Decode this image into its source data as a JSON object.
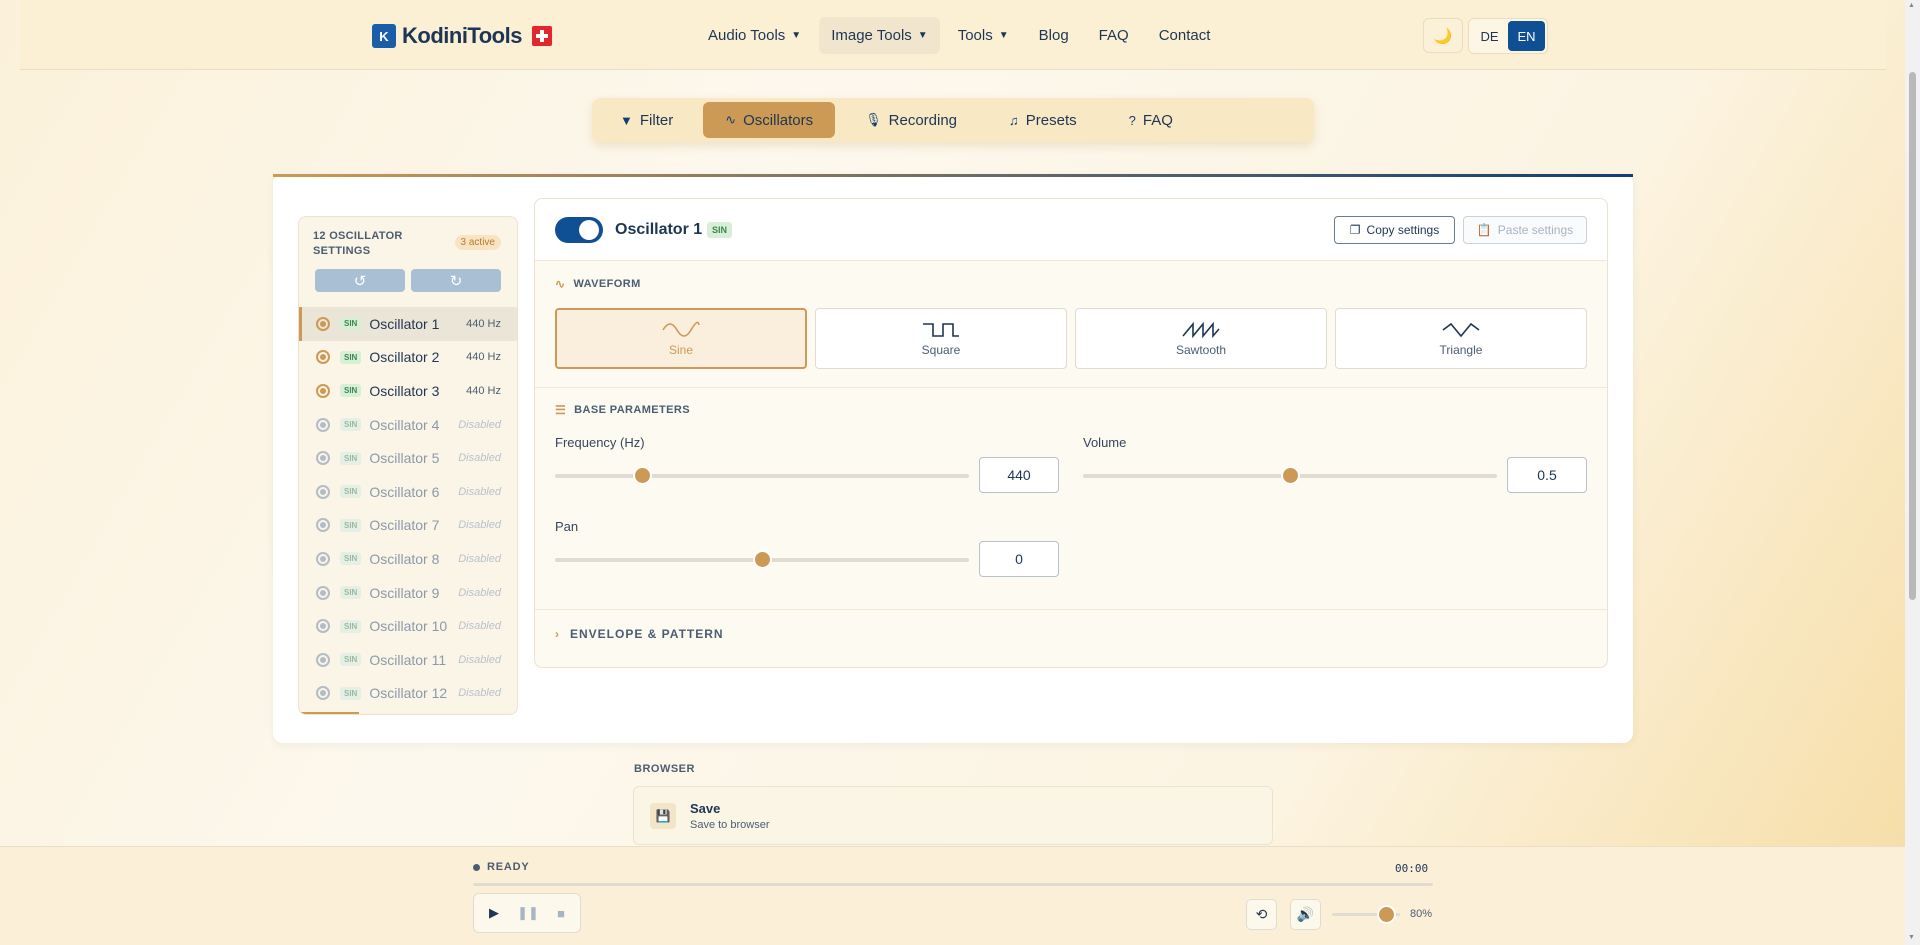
{
  "header": {
    "logo_mark": "K",
    "brand": "KodiniTools",
    "nav": [
      {
        "label": "Audio Tools",
        "dropdown": true
      },
      {
        "label": "Image Tools",
        "dropdown": true
      },
      {
        "label": "Tools",
        "dropdown": true
      },
      {
        "label": "Blog",
        "dropdown": false
      },
      {
        "label": "FAQ",
        "dropdown": false
      },
      {
        "label": "Contact",
        "dropdown": false
      }
    ],
    "theme_icon": "moon-icon",
    "theme_glyph": "🌙",
    "languages": [
      "DE",
      "EN"
    ],
    "active_language": "EN"
  },
  "tabs": [
    {
      "label": "Filter",
      "icon": "filter-icon",
      "glyph": "▼"
    },
    {
      "label": "Oscillators",
      "icon": "wave-icon",
      "glyph": "∿"
    },
    {
      "label": "Recording",
      "icon": "microphone-icon",
      "glyph": "🎙"
    },
    {
      "label": "Presets",
      "icon": "music-note-icon",
      "glyph": "♫"
    },
    {
      "label": "FAQ",
      "icon": "question-icon",
      "glyph": "?"
    }
  ],
  "active_tab": "Oscillators",
  "sidebar": {
    "title": "12 OSCILLATOR SETTINGS",
    "active_badge": "3 active",
    "undo_glyph": "↺",
    "redo_glyph": "↻",
    "oscillators": [
      {
        "name": "Oscillator 1",
        "wave": "SIN",
        "status": "440 Hz",
        "enabled": true
      },
      {
        "name": "Oscillator 2",
        "wave": "SIN",
        "status": "440 Hz",
        "enabled": true
      },
      {
        "name": "Oscillator 3",
        "wave": "SIN",
        "status": "440 Hz",
        "enabled": true
      },
      {
        "name": "Oscillator 4",
        "wave": "SIN",
        "status": "Disabled",
        "enabled": false
      },
      {
        "name": "Oscillator 5",
        "wave": "SIN",
        "status": "Disabled",
        "enabled": false
      },
      {
        "name": "Oscillator 6",
        "wave": "SIN",
        "status": "Disabled",
        "enabled": false
      },
      {
        "name": "Oscillator 7",
        "wave": "SIN",
        "status": "Disabled",
        "enabled": false
      },
      {
        "name": "Oscillator 8",
        "wave": "SIN",
        "status": "Disabled",
        "enabled": false
      },
      {
        "name": "Oscillator 9",
        "wave": "SIN",
        "status": "Disabled",
        "enabled": false
      },
      {
        "name": "Oscillator 10",
        "wave": "SIN",
        "status": "Disabled",
        "enabled": false
      },
      {
        "name": "Oscillator 11",
        "wave": "SIN",
        "status": "Disabled",
        "enabled": false
      },
      {
        "name": "Oscillator 12",
        "wave": "SIN",
        "status": "Disabled",
        "enabled": false
      }
    ]
  },
  "panel": {
    "title": "Oscillator 1",
    "wave_tag": "SIN",
    "enabled": true,
    "copy_label": "Copy settings",
    "paste_label": "Paste settings",
    "waveform_label": "WAVEFORM",
    "waveforms": [
      "Sine",
      "Square",
      "Sawtooth",
      "Triangle"
    ],
    "selected_waveform": "Sine",
    "base_label": "BASE PARAMETERS",
    "frequency": {
      "label": "Frequency (Hz)",
      "value": "440",
      "fraction": 0.21
    },
    "volume": {
      "label": "Volume",
      "value": "0.5",
      "fraction": 0.5
    },
    "pan": {
      "label": "Pan",
      "value": "0",
      "fraction": 0.5
    },
    "envelope_label": "ENVELOPE & PATTERN"
  },
  "browser": {
    "label": "BROWSER",
    "save_title": "Save",
    "save_subtitle": "Save to browser"
  },
  "player": {
    "status": "READY",
    "time": "00:00",
    "progress": 0,
    "volume_percent": "80%",
    "volume_fraction": 0.8
  },
  "colors": {
    "accent": "#cc9a55",
    "primary": "#0f4f94",
    "text": "#1e3655"
  }
}
